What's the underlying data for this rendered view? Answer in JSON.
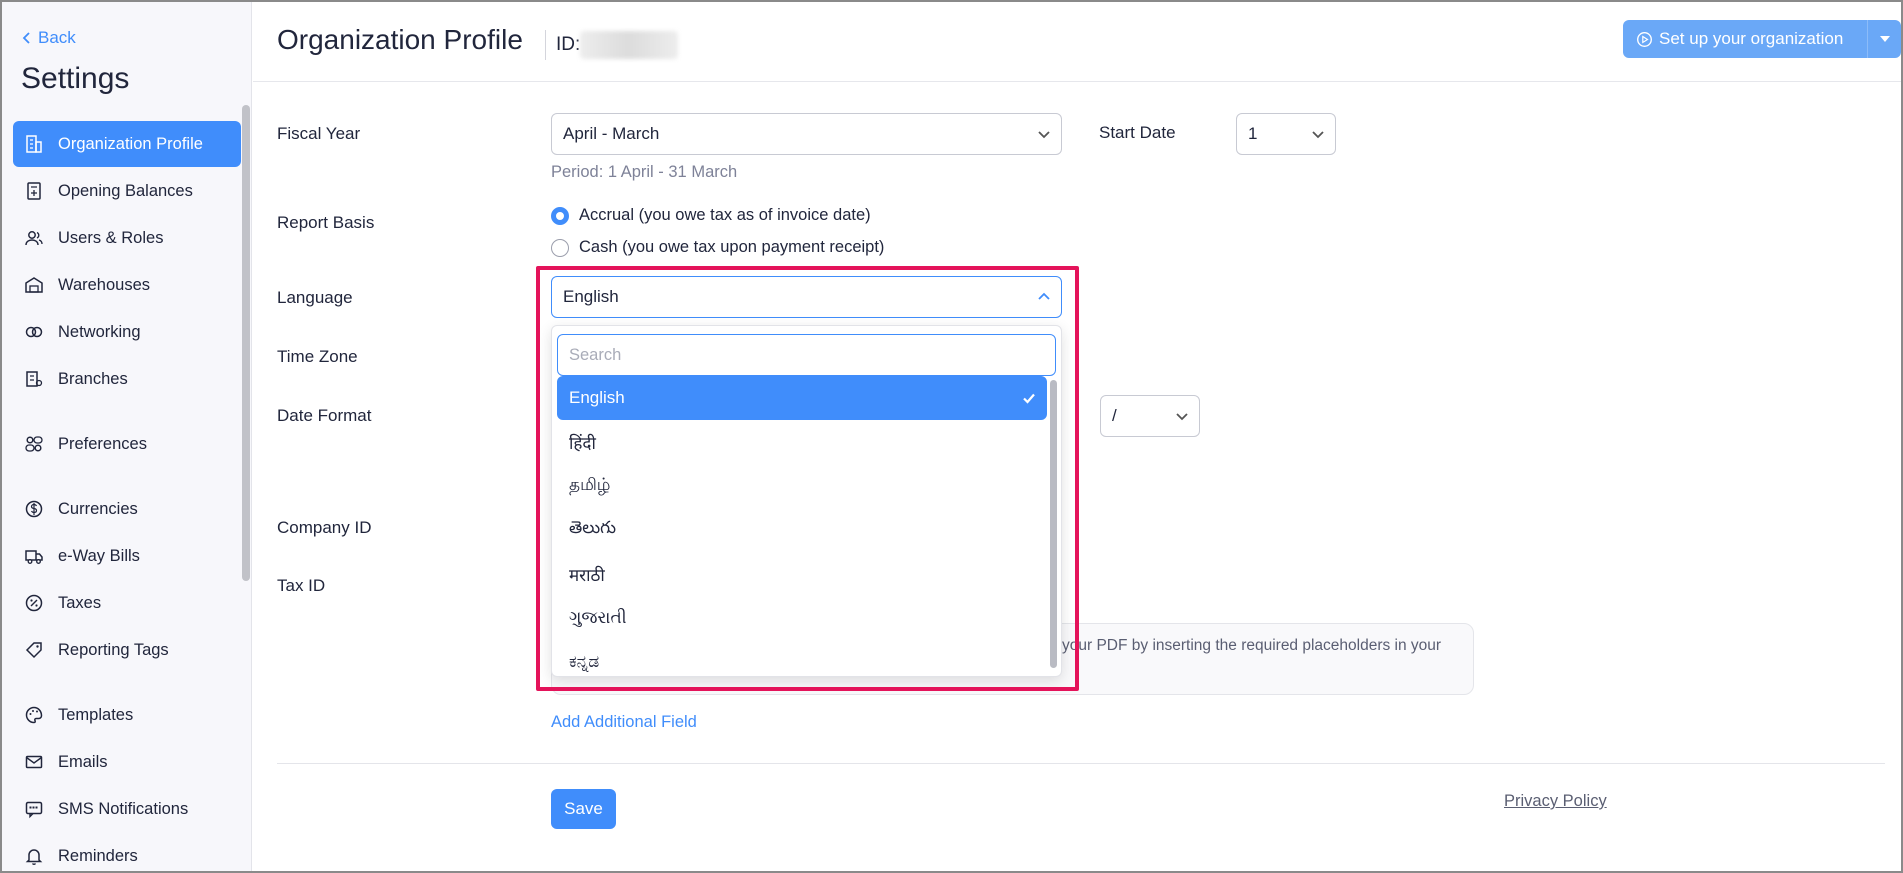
{
  "sidebar": {
    "back_label": "Back",
    "title": "Settings",
    "items": [
      {
        "label": "Organization Profile",
        "icon": "building-icon",
        "active": true
      },
      {
        "label": "Opening Balances",
        "icon": "ledger-icon"
      },
      {
        "label": "Users & Roles",
        "icon": "users-icon"
      },
      {
        "label": "Warehouses",
        "icon": "warehouse-icon"
      },
      {
        "label": "Networking",
        "icon": "network-icon"
      },
      {
        "label": "Branches",
        "icon": "branch-icon"
      },
      {
        "label": "Preferences",
        "icon": "preferences-icon"
      },
      {
        "label": "Currencies",
        "icon": "currency-icon"
      },
      {
        "label": "e-Way Bills",
        "icon": "truck-icon"
      },
      {
        "label": "Taxes",
        "icon": "percent-icon"
      },
      {
        "label": "Reporting Tags",
        "icon": "tag-icon"
      },
      {
        "label": "Templates",
        "icon": "palette-icon"
      },
      {
        "label": "Emails",
        "icon": "mail-icon"
      },
      {
        "label": "SMS Notifications",
        "icon": "sms-icon"
      },
      {
        "label": "Reminders",
        "icon": "bell-icon"
      }
    ]
  },
  "header": {
    "title": "Organization Profile",
    "id_label": "ID:",
    "setup_button": "Set up your organization"
  },
  "form": {
    "fiscal_year_label": "Fiscal Year",
    "fiscal_year_value": "April - March",
    "period_hint": "Period: 1 April - 31 March",
    "start_date_label": "Start Date",
    "start_date_value": "1",
    "report_basis_label": "Report Basis",
    "accrual_label": "Accrual (you owe tax as of invoice date)",
    "cash_label": "Cash (you owe tax upon payment receipt)",
    "language_label": "Language",
    "language_value": "English",
    "time_zone_label": "Time Zone",
    "date_format_label": "Date Format",
    "date_separator_value": "/",
    "company_id_label": "Company ID",
    "tax_id_label": "Tax ID",
    "info_text": "your PDF by inserting the required placeholders in your",
    "add_field": "Add Additional Field",
    "save": "Save",
    "privacy": "Privacy Policy"
  },
  "language_dropdown": {
    "search_placeholder": "Search",
    "options": [
      "English",
      "हिंदी",
      "தமிழ்",
      "తెలుగు",
      "मराठी",
      "ગુજરાતી",
      "ಕನ್ನಡ"
    ],
    "selected": "English"
  },
  "colors": {
    "accent": "#408dfb",
    "highlight": "#e4135a"
  }
}
